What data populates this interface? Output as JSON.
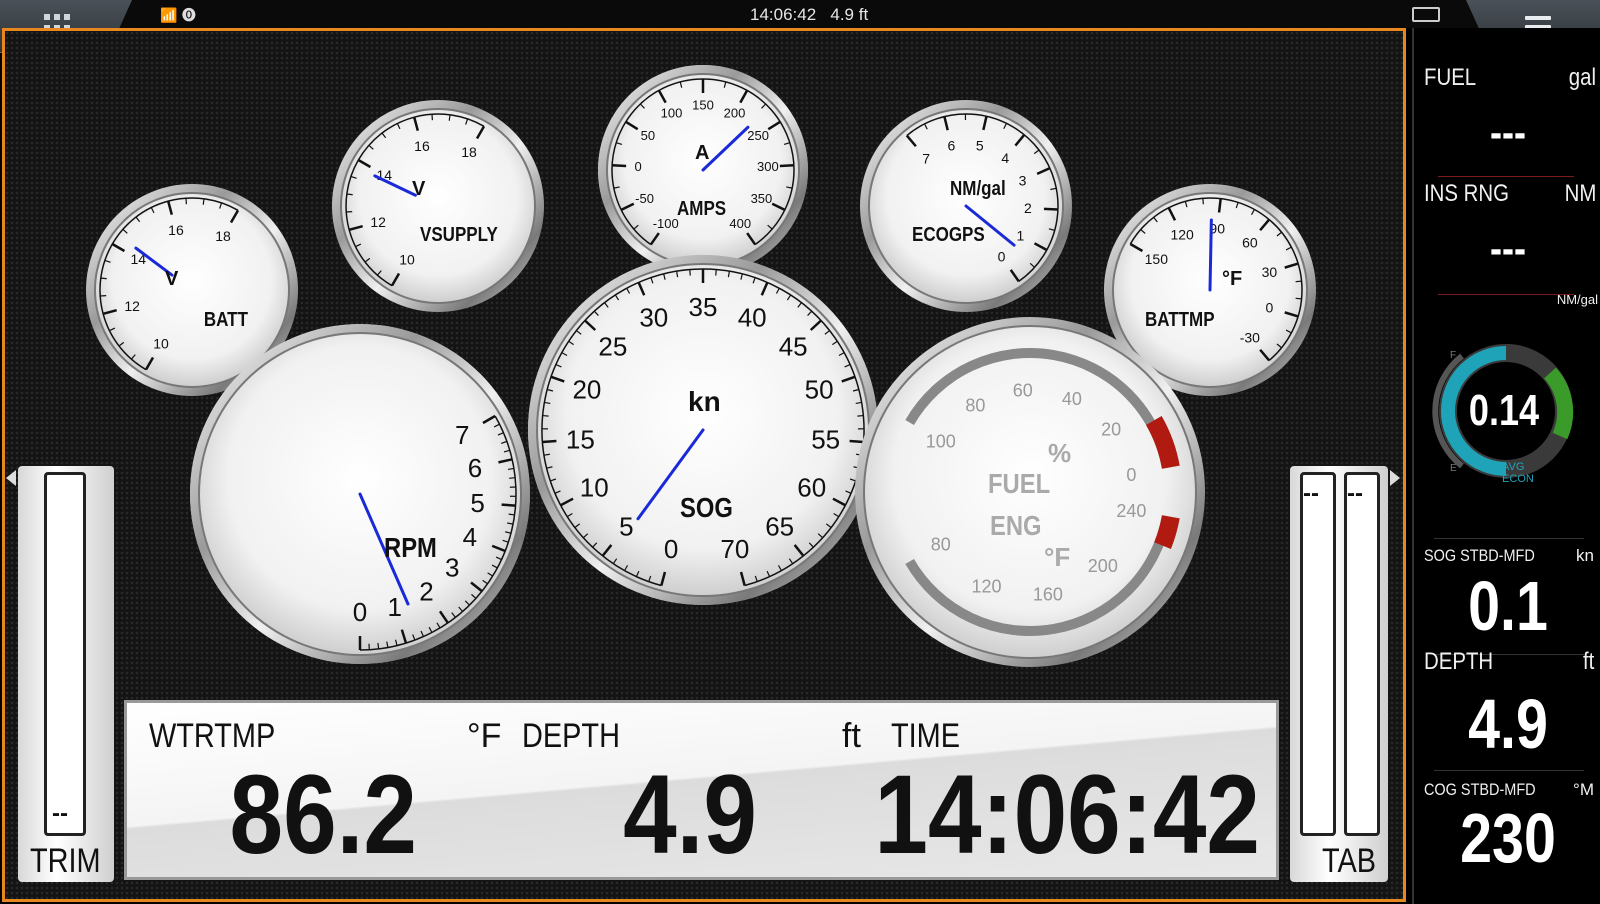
{
  "topbar": {
    "time": "14:06:42",
    "depth": "4.9 ft",
    "status_icons": [
      "gps-signal-icon",
      "alarm-icon"
    ]
  },
  "gauges": {
    "batt": {
      "label": "BATT",
      "unit": "V",
      "ticks": [
        "10",
        "12",
        "14",
        "16",
        "18"
      ],
      "value": 14.3
    },
    "vsupply": {
      "label": "VSUPPLY",
      "unit": "V",
      "ticks": [
        "10",
        "12",
        "14",
        "16",
        "18"
      ],
      "value": 13.8
    },
    "amps": {
      "label": "AMPS",
      "unit": "A",
      "ticks": [
        "-100",
        "-50",
        "0",
        "50",
        "100",
        "150",
        "200",
        "250",
        "300",
        "350",
        "400"
      ],
      "value": 230
    },
    "ecogps": {
      "label": "ECOGPS",
      "unit": "NM/gal",
      "ticks": [
        "0",
        "1",
        "2",
        "3",
        "4",
        "5",
        "6",
        "7"
      ],
      "value": 0.14
    },
    "battmp": {
      "label": "BATTMP",
      "unit": "°F",
      "ticks": [
        "-30",
        "0",
        "30",
        "60",
        "90",
        "120",
        "150"
      ],
      "value": 95
    },
    "rpm": {
      "label": "RPM",
      "ticks": [
        "0",
        "1",
        "2",
        "3",
        "4",
        "5",
        "6",
        "7"
      ],
      "value": 1.1
    },
    "sog": {
      "label": "SOG",
      "unit": "kn",
      "ticks": [
        "0",
        "5",
        "10",
        "15",
        "20",
        "25",
        "30",
        "35",
        "40",
        "45",
        "50",
        "55",
        "60",
        "65",
        "70"
      ],
      "value": 0.1
    },
    "fuel_eng": {
      "label_fuel": "FUEL",
      "label_eng": "ENG",
      "unit_pct": "%",
      "unit_temp": "°F",
      "pct_ticks": [
        "100",
        "80",
        "60",
        "40",
        "20",
        "0"
      ],
      "temp_ticks": [
        "80",
        "120",
        "160",
        "200",
        "240"
      ]
    }
  },
  "trim": {
    "label": "TRIM",
    "value": "--"
  },
  "tab": {
    "label": "TAB",
    "left_value": "--",
    "right_value": "--"
  },
  "data_panel": {
    "wtrtmp": {
      "label": "WTRTMP",
      "unit": "°F",
      "value": "86.2"
    },
    "depth": {
      "label": "DEPTH",
      "unit": "ft",
      "value": "4.9"
    },
    "time": {
      "label": "TIME",
      "value": "14:06:42"
    }
  },
  "sidebar": {
    "fuel": {
      "label": "FUEL",
      "unit": "gal",
      "value": "---"
    },
    "ins_rng": {
      "label": "INS RNG",
      "unit": "NM",
      "value": "---"
    },
    "econ": {
      "unit": "NM/gal",
      "value": "0.14",
      "avg": "AVG",
      "econ": "ECON",
      "f": "F",
      "e": "E"
    },
    "sog": {
      "label": "SOG STBD-MFD",
      "unit": "kn",
      "value": "0.1"
    },
    "depth": {
      "label": "DEPTH",
      "unit": "ft",
      "value": "4.9"
    },
    "cog": {
      "label": "COG STBD-MFD",
      "unit": "°M",
      "value": "230"
    }
  },
  "colors": {
    "accent": "#e8871e",
    "needle": "#1a2ad8",
    "redzone": "#e01a10",
    "econ_teal": "#1fa3b8",
    "econ_green": "#3a9a2a"
  }
}
